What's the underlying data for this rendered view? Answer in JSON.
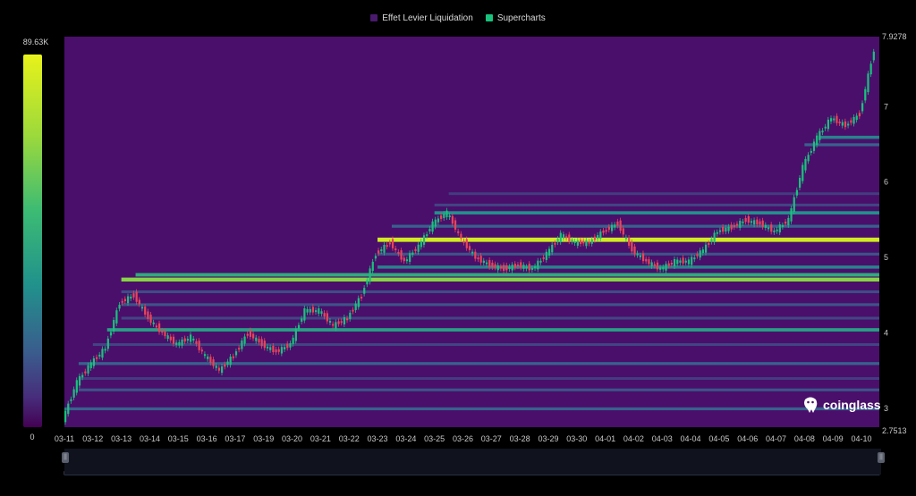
{
  "legend": {
    "items": [
      {
        "label": "Effet Levier Liquidation",
        "color": "#4a1a6e"
      },
      {
        "label": "Supercharts",
        "color": "#19c27d"
      }
    ]
  },
  "colorscale": {
    "max_label": "89.63K",
    "min_label": "0",
    "colors": [
      "#440154",
      "#472d7b",
      "#3a5c8d",
      "#21918c",
      "#3cbb74",
      "#9bd93c",
      "#e8f21a"
    ]
  },
  "watermark": {
    "text": "coinglass",
    "icon": "coinglass-frog-icon"
  },
  "chart_data": {
    "type": "heatmap",
    "title": "",
    "xlabel": "",
    "ylabel": "",
    "ylim": [
      2.7513,
      7.9278
    ],
    "y_ticks": [
      "3",
      "4",
      "5",
      "6",
      "7"
    ],
    "y_top_label": "7.9278",
    "y_bottom_label": "2.7513",
    "x_labels": [
      "03-11",
      "03-12",
      "03-13",
      "03-14",
      "03-15",
      "03-16",
      "03-17",
      "03-19",
      "03-20",
      "03-21",
      "03-22",
      "03-23",
      "03-24",
      "03-25",
      "03-26",
      "03-27",
      "03-28",
      "03-29",
      "03-30",
      "04-01",
      "04-02",
      "04-03",
      "04-04",
      "04-05",
      "04-06",
      "04-07",
      "04-08",
      "04-09",
      "04-10"
    ],
    "background_color": "#4a0f6b",
    "price_series": {
      "name": "Supercharts",
      "x": [
        "03-11",
        "03-11",
        "03-12",
        "03-12",
        "03-13",
        "03-13",
        "03-14",
        "03-14",
        "03-15",
        "03-15",
        "03-16",
        "03-16",
        "03-17",
        "03-17",
        "03-19",
        "03-19",
        "03-20",
        "03-20",
        "03-21",
        "03-21",
        "03-22",
        "03-22",
        "03-23",
        "03-23",
        "03-24",
        "03-24",
        "03-25",
        "03-25",
        "03-26",
        "03-26",
        "03-27",
        "03-27",
        "03-28",
        "03-28",
        "03-29",
        "03-29",
        "03-30",
        "03-30",
        "04-01",
        "04-01",
        "04-02",
        "04-02",
        "04-03",
        "04-03",
        "04-04",
        "04-04",
        "04-05",
        "04-05",
        "04-06",
        "04-06",
        "04-07",
        "04-07",
        "04-08",
        "04-08",
        "04-09",
        "04-09",
        "04-10",
        "04-10"
      ],
      "values": [
        2.85,
        3.35,
        3.6,
        3.8,
        4.4,
        4.5,
        4.2,
        4.0,
        3.85,
        3.95,
        3.7,
        3.5,
        3.7,
        4.0,
        3.85,
        3.75,
        3.85,
        4.3,
        4.3,
        4.1,
        4.2,
        4.5,
        5.05,
        5.2,
        4.95,
        5.15,
        5.45,
        5.6,
        5.25,
        5.0,
        4.9,
        4.85,
        4.9,
        4.85,
        5.05,
        5.3,
        5.2,
        5.2,
        5.35,
        5.45,
        5.1,
        4.95,
        4.85,
        4.95,
        4.95,
        5.1,
        5.35,
        5.4,
        5.5,
        5.45,
        5.35,
        5.5,
        6.2,
        6.6,
        6.85,
        6.75,
        6.9,
        7.75
      ]
    },
    "liquidation_bands": [
      {
        "price": 5.25,
        "intensity": 0.95
      },
      {
        "price": 4.72,
        "intensity": 0.8
      },
      {
        "price": 4.78,
        "intensity": 0.6
      },
      {
        "price": 4.05,
        "intensity": 0.55
      },
      {
        "price": 4.88,
        "intensity": 0.45
      },
      {
        "price": 5.6,
        "intensity": 0.5
      },
      {
        "price": 5.42,
        "intensity": 0.35
      },
      {
        "price": 6.6,
        "intensity": 0.45
      },
      {
        "price": 6.5,
        "intensity": 0.35
      },
      {
        "price": 3.6,
        "intensity": 0.35
      },
      {
        "price": 3.25,
        "intensity": 0.3
      },
      {
        "price": 3.0,
        "intensity": 0.35
      },
      {
        "price": 4.38,
        "intensity": 0.3
      },
      {
        "price": 4.55,
        "intensity": 0.28
      },
      {
        "price": 5.7,
        "intensity": 0.25
      },
      {
        "price": 5.85,
        "intensity": 0.22
      },
      {
        "price": 5.05,
        "intensity": 0.3
      },
      {
        "price": 3.85,
        "intensity": 0.25
      },
      {
        "price": 3.4,
        "intensity": 0.22
      },
      {
        "price": 4.2,
        "intensity": 0.25
      }
    ]
  }
}
